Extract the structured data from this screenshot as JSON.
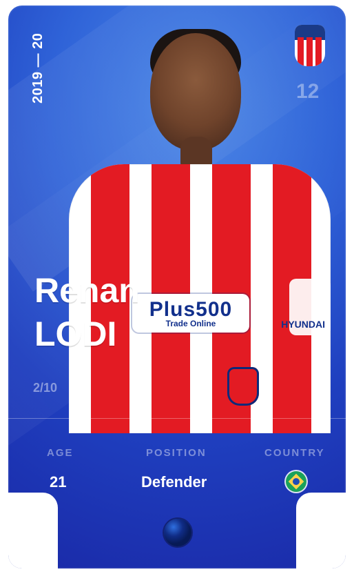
{
  "card": {
    "season": "2019 — 20",
    "jersey_number": "12",
    "player": {
      "first_name": "Renan",
      "last_name": "LODI"
    },
    "edition": "2/10",
    "stats": {
      "age_label": "AGE",
      "age_value": "21",
      "position_label": "POSITION",
      "position_value": "Defender",
      "country_label": "COUNTRY",
      "country_flag_icon": "brazil-flag-icon"
    }
  },
  "colors": {
    "card_gradient": [
      "#4a86e6",
      "#2f63d8",
      "#1f3fbf",
      "#1a2aa8"
    ],
    "text_primary": "#ffffff",
    "text_muted": "rgba(255,255,255,0.42)"
  },
  "icons": {
    "club_crest": "club-crest-icon",
    "rarity_orb": "rarity-orb-icon"
  }
}
